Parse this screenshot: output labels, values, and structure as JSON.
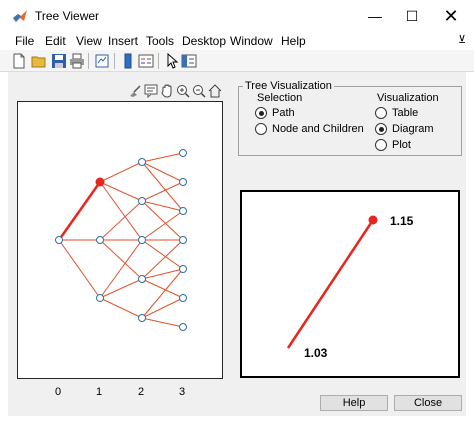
{
  "window": {
    "title": "Tree Viewer",
    "minimize_glyph": "—",
    "maximize_glyph": "☐",
    "close_glyph": "✕"
  },
  "menu": {
    "items": [
      "File",
      "Edit",
      "View",
      "Insert",
      "Tools",
      "Desktop",
      "Window",
      "Help"
    ],
    "pin_glyph": "⊻"
  },
  "toolbar": {
    "icons": [
      "new-figure-icon",
      "open-file-icon",
      "save-icon",
      "print-icon",
      "export-icon",
      "colorbar-icon",
      "legend-icon",
      "pointer-icon",
      "property-inspector-icon"
    ]
  },
  "axes_toolbar": {
    "icons": [
      "brush-icon",
      "data-tips-icon",
      "pan-icon",
      "zoom-in-icon",
      "zoom-out-icon",
      "home-icon"
    ]
  },
  "tree_plot": {
    "x_ticks": [
      "0",
      "1",
      "2",
      "3"
    ],
    "line_color": "#e0522b",
    "node_color": "#2f6da8",
    "highlight_color": "#e8261c"
  },
  "panel": {
    "title": "Tree Visualization",
    "selection": {
      "label": "Selection",
      "options": [
        {
          "label": "Path",
          "selected": true
        },
        {
          "label": "Node and Children",
          "selected": false
        }
      ]
    },
    "visualization": {
      "label": "Visualization",
      "options": [
        {
          "label": "Table",
          "selected": false
        },
        {
          "label": "Diagram",
          "selected": true
        },
        {
          "label": "Plot",
          "selected": false
        }
      ]
    }
  },
  "path_plot": {
    "start_label": "1.03",
    "end_label": "1.15",
    "color": "#e8261c"
  },
  "buttons": {
    "help": "Help",
    "close": "Close"
  }
}
